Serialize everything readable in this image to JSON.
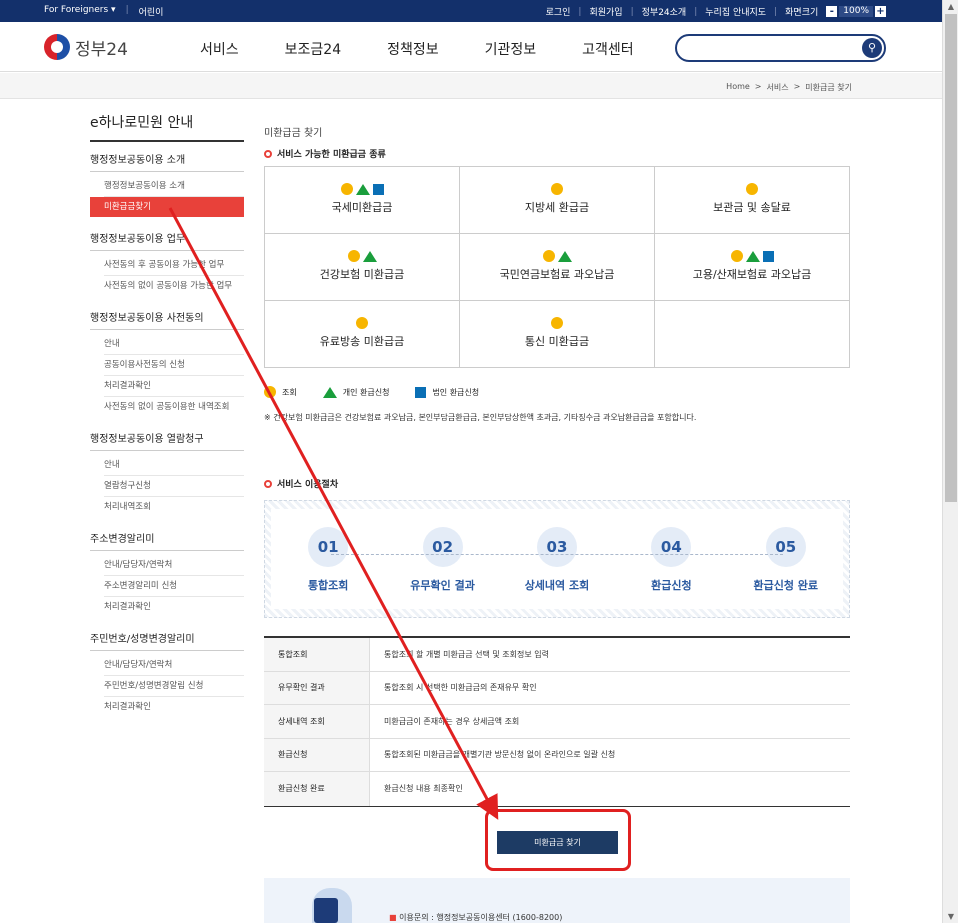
{
  "topbar": {
    "foreigners": "For Foreigners ▾",
    "kids": "어린이",
    "login": "로그인",
    "join": "회원가입",
    "intro": "정부24소개",
    "guide": "누리집 안내지도",
    "fontsize": "화면크기",
    "zoom": "100%",
    "minus": "-",
    "plus": "+"
  },
  "header": {
    "logo": "정부24",
    "nav": [
      "서비스",
      "보조금24",
      "정책정보",
      "기관정보",
      "고객센터"
    ],
    "search_placeholder": ""
  },
  "breadcrumb": {
    "home": "Home",
    "sep": ">",
    "service": "서비스",
    "current": "미환급금 찾기"
  },
  "lnb": {
    "title": "e하나로민원 안내",
    "groups": [
      {
        "label": "행정정보공동이용 소개",
        "items": [
          "행정정보공동이용 소개",
          "미환급금찾기"
        ]
      },
      {
        "label": "행정정보공동이용 업무",
        "items": [
          "사전동의 후 공동이용 가능한 업무",
          "사전동의 없이 공동이용 가능한 업무"
        ]
      },
      {
        "label": "행정정보공동이용 사전동의",
        "items": [
          "안내",
          "공동이용사전동의 신청",
          "처리결과확인",
          "사전동의 없이 공동이용한 내역조회"
        ]
      },
      {
        "label": "행정정보공동이용 열람청구",
        "items": [
          "안내",
          "열람청구신청",
          "처리내역조회"
        ]
      },
      {
        "label": "주소변경알리미",
        "items": [
          "안내/담당자/연락처",
          "주소변경알리미 신청",
          "처리결과확인"
        ]
      },
      {
        "label": "주민번호/성명변경알리미",
        "items": [
          "안내/담당자/연락처",
          "주민번호/성명변경알림 신청",
          "처리결과확인"
        ]
      }
    ]
  },
  "main": {
    "page_title": "미환급금 찾기",
    "sec1": "서비스 가능한 미환급금 종류",
    "cells": [
      {
        "name": "국세미환급금",
        "icons": [
          "dot",
          "tri",
          "sq"
        ]
      },
      {
        "name": "지방세 환급금",
        "icons": [
          "dot"
        ]
      },
      {
        "name": "보관금 및 송달료",
        "icons": [
          "dot"
        ]
      },
      {
        "name": "건강보험 미환급금",
        "icons": [
          "dot",
          "tri"
        ]
      },
      {
        "name": "국민연금보험료 과오납금",
        "icons": [
          "dot",
          "tri"
        ]
      },
      {
        "name": "고용/산재보험료 과오납금",
        "icons": [
          "dot",
          "tri",
          "sq"
        ]
      },
      {
        "name": "유료방송 미환급금",
        "icons": [
          "dot"
        ]
      },
      {
        "name": "통신 미환급금",
        "icons": [
          "dot"
        ]
      },
      {
        "name": "",
        "icons": []
      }
    ],
    "legend": {
      "dot": "조회",
      "tri": "개인 환급신청",
      "sq": "법인 환급신청"
    },
    "note": "※ 건강보험 미환급금은 건강보험료 과오납금, 본인부담금환급금, 본인부담상한액 초과금, 기타징수금 과오납환급금을 포함합니다.",
    "sec2": "서비스 이용절차",
    "steps": [
      {
        "n": "01",
        "l": "통합조회"
      },
      {
        "n": "02",
        "l": "유무확인 결과"
      },
      {
        "n": "03",
        "l": "상세내역 조회"
      },
      {
        "n": "04",
        "l": "환급신청"
      },
      {
        "n": "05",
        "l": "환급신청 완료"
      }
    ],
    "table": [
      {
        "k": "통합조회",
        "v": "통합조회 할 개별 미환급금 선택 및 조회정보 입력"
      },
      {
        "k": "유무확인 결과",
        "v": "통합조회 시 선택한 미환급금의 존재유무 확인"
      },
      {
        "k": "상세내역 조회",
        "v": "미환급금이 존재하는 경우 상세금액 조회"
      },
      {
        "k": "환급신청",
        "v": "통합조회된 미환급금을 개별기관 방문신청 없이 온라인으로 일괄 신청"
      },
      {
        "k": "환급신청 완료",
        "v": "환급신청 내용 최종확인"
      }
    ],
    "find_button": "미환급금 찾기",
    "info": {
      "label": "이용문의 :",
      "value": "행정정보공동이용센터 (1600-8200)"
    }
  },
  "colors": {
    "navy": "#13306b",
    "accent": "#e8413a",
    "annotation": "#e02020"
  }
}
